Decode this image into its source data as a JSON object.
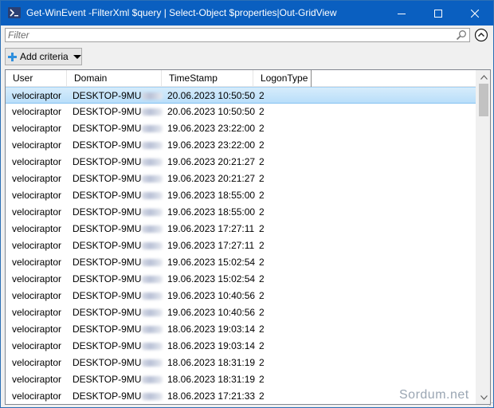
{
  "window": {
    "title": "Get-WinEvent -FilterXml $query | Select-Object $properties|Out-GridView",
    "icon": "powershell-icon"
  },
  "filter": {
    "placeholder": "Filter",
    "value": ""
  },
  "toolbar": {
    "add_criteria_label": "Add criteria"
  },
  "grid": {
    "columns": [
      "User",
      "Domain",
      "TimeStamp",
      "LogonType"
    ],
    "rows": [
      {
        "user": "velociraptor",
        "domain": "DESKTOP-9MU",
        "timestamp": "20.06.2023 10:50:50",
        "logon_type": "2",
        "selected": true
      },
      {
        "user": "velociraptor",
        "domain": "DESKTOP-9MU",
        "timestamp": "20.06.2023 10:50:50",
        "logon_type": "2"
      },
      {
        "user": "velociraptor",
        "domain": "DESKTOP-9MU",
        "timestamp": "19.06.2023 23:22:00",
        "logon_type": "2"
      },
      {
        "user": "velociraptor",
        "domain": "DESKTOP-9MU",
        "timestamp": "19.06.2023 23:22:00",
        "logon_type": "2"
      },
      {
        "user": "velociraptor",
        "domain": "DESKTOP-9MU",
        "timestamp": "19.06.2023 20:21:27",
        "logon_type": "2"
      },
      {
        "user": "velociraptor",
        "domain": "DESKTOP-9MU",
        "timestamp": "19.06.2023 20:21:27",
        "logon_type": "2"
      },
      {
        "user": "velociraptor",
        "domain": "DESKTOP-9MU",
        "timestamp": "19.06.2023 18:55:00",
        "logon_type": "2"
      },
      {
        "user": "velociraptor",
        "domain": "DESKTOP-9MU",
        "timestamp": "19.06.2023 18:55:00",
        "logon_type": "2"
      },
      {
        "user": "velociraptor",
        "domain": "DESKTOP-9MU",
        "timestamp": "19.06.2023 17:27:11",
        "logon_type": "2"
      },
      {
        "user": "velociraptor",
        "domain": "DESKTOP-9MU",
        "timestamp": "19.06.2023 17:27:11",
        "logon_type": "2"
      },
      {
        "user": "velociraptor",
        "domain": "DESKTOP-9MU",
        "timestamp": "19.06.2023 15:02:54",
        "logon_type": "2"
      },
      {
        "user": "velociraptor",
        "domain": "DESKTOP-9MU",
        "timestamp": "19.06.2023 15:02:54",
        "logon_type": "2"
      },
      {
        "user": "velociraptor",
        "domain": "DESKTOP-9MU",
        "timestamp": "19.06.2023 10:40:56",
        "logon_type": "2"
      },
      {
        "user": "velociraptor",
        "domain": "DESKTOP-9MU",
        "timestamp": "19.06.2023 10:40:56",
        "logon_type": "2"
      },
      {
        "user": "velociraptor",
        "domain": "DESKTOP-9MU",
        "timestamp": "18.06.2023 19:03:14",
        "logon_type": "2"
      },
      {
        "user": "velociraptor",
        "domain": "DESKTOP-9MU",
        "timestamp": "18.06.2023 19:03:14",
        "logon_type": "2"
      },
      {
        "user": "velociraptor",
        "domain": "DESKTOP-9MU",
        "timestamp": "18.06.2023 18:31:19",
        "logon_type": "2"
      },
      {
        "user": "velociraptor",
        "domain": "DESKTOP-9MU",
        "timestamp": "18.06.2023 18:31:19",
        "logon_type": "2"
      },
      {
        "user": "velociraptor",
        "domain": "DESKTOP-9MU",
        "timestamp": "18.06.2023 17:21:33",
        "logon_type": "2"
      }
    ]
  },
  "watermark": "Sordum.net",
  "colors": {
    "titlebar": "#0a5fc0",
    "selected_row": "#c3e3fa",
    "grid_border": "#828790"
  }
}
